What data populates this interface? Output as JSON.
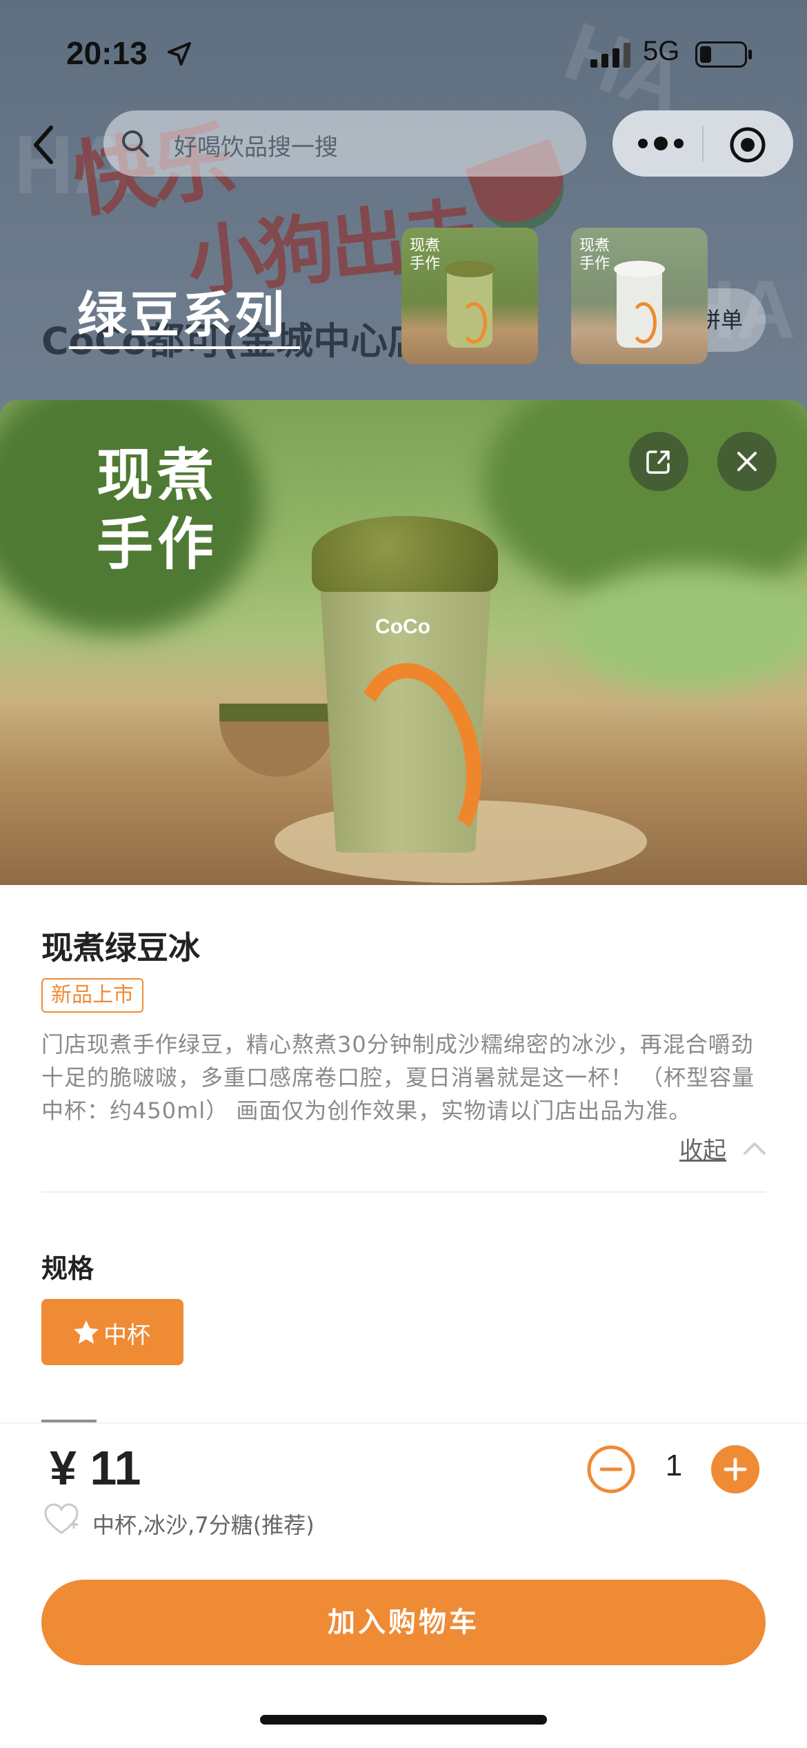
{
  "status_bar": {
    "time": "20:13",
    "network": "5G"
  },
  "nav": {
    "search_placeholder": "好喝饮品搜一搜"
  },
  "background": {
    "art_text_1": "快乐",
    "art_text_2": "小狗出击",
    "store_name": "CoCo都可(金城中心店",
    "pin_button": "拼单",
    "series_title": "绿豆系列",
    "thumb_label": "现煮\n手作"
  },
  "hero": {
    "overlay_text_line1": "现煮",
    "overlay_text_line2": "手作",
    "cup_logo": "CoCo"
  },
  "product": {
    "name": "现煮绿豆冰",
    "badge": "新品上市",
    "description": "门店现煮手作绿豆，精心熬煮30分钟制成沙糯绵密的冰沙，再混合嚼劲十足的脆啵啵，多重口感席卷口腔，夏日消暑就是这一杯！ （杯型容量 中杯：约450ml） 画面仅为创作效果，实物请以门店出品为准。",
    "collapse_label": "收起"
  },
  "spec": {
    "title": "规格",
    "options": [
      {
        "label": "中杯",
        "selected": true
      }
    ]
  },
  "footer": {
    "price": "¥ 11",
    "selection_summary": "中杯,冰沙,7分糖(推荐)",
    "quantity": "1",
    "add_to_cart": "加入购物车"
  },
  "colors": {
    "accent": "#ef8a35",
    "text": "#222222",
    "muted": "#8a8a8a"
  },
  "icons": [
    "location-arrow-icon",
    "signal-icon",
    "battery-icon",
    "back-chevron-icon",
    "search-icon",
    "more-dots-icon",
    "target-icon",
    "share-icon",
    "close-icon",
    "chevron-up-icon",
    "star-icon",
    "heart-icon",
    "minus-circle-icon",
    "plus-circle-icon"
  ]
}
